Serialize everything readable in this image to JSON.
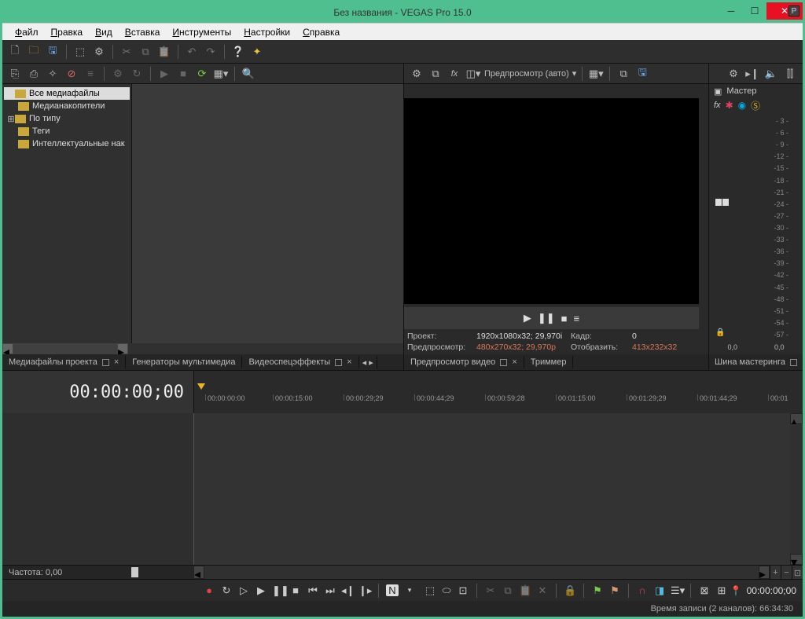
{
  "title": "Без названия - VEGAS Pro 15.0",
  "menu": [
    "Файл",
    "Правка",
    "Вид",
    "Вставка",
    "Инструменты",
    "Настройки",
    "Справка"
  ],
  "tree": {
    "all": "Все медиафайлы",
    "storage": "Медианакопители",
    "bytype": "По типу",
    "tags": "Теги",
    "smart": "Интеллектуальные нак"
  },
  "tabs": {
    "media": "Медиафайлы проекта",
    "gen": "Генераторы мультимедиа",
    "fx": "Видеоспецэффекты",
    "prevvid": "Предпросмотр видео",
    "trimmer": "Триммер",
    "mastering": "Шина мастеринга"
  },
  "preview": {
    "ddlabel": "Предпросмотр (авто)",
    "proj_lbl": "Проект:",
    "proj_val": "1920x1080x32; 29,970i",
    "frame_lbl": "Кадр:",
    "frame_val": "0",
    "prev_lbl": "Предпросмотр:",
    "prev_val": "480x270x32; 29,970p",
    "disp_lbl": "Отобразить:",
    "disp_val": "413x232x32"
  },
  "master": {
    "label": "Мастер",
    "scale": [
      "- 3 -",
      "- 6 -",
      "- 9 -",
      "-12 -",
      "-15 -",
      "-18 -",
      "-21 -",
      "-24 -",
      "-27 -",
      "-30 -",
      "-33 -",
      "-36 -",
      "-39 -",
      "-42 -",
      "-45 -",
      "-48 -",
      "-51 -",
      "-54 -",
      "-57 -"
    ],
    "v1": "0,0",
    "v2": "0,0"
  },
  "timeline": {
    "tc": "00:00:00;00",
    "ticks": [
      "00:00:00:00",
      "00:00:15:00",
      "00:00:29;29",
      "00:00:44;29",
      "00:00:59;28",
      "00:01:15:00",
      "00:01:29;29",
      "00:01:44;29",
      "00:01"
    ],
    "rate_lbl": "Частота:",
    "rate_val": "0,00",
    "trans_tc": "00:00:00;00"
  },
  "status": "Время записи (2 каналов): 66:34:30"
}
